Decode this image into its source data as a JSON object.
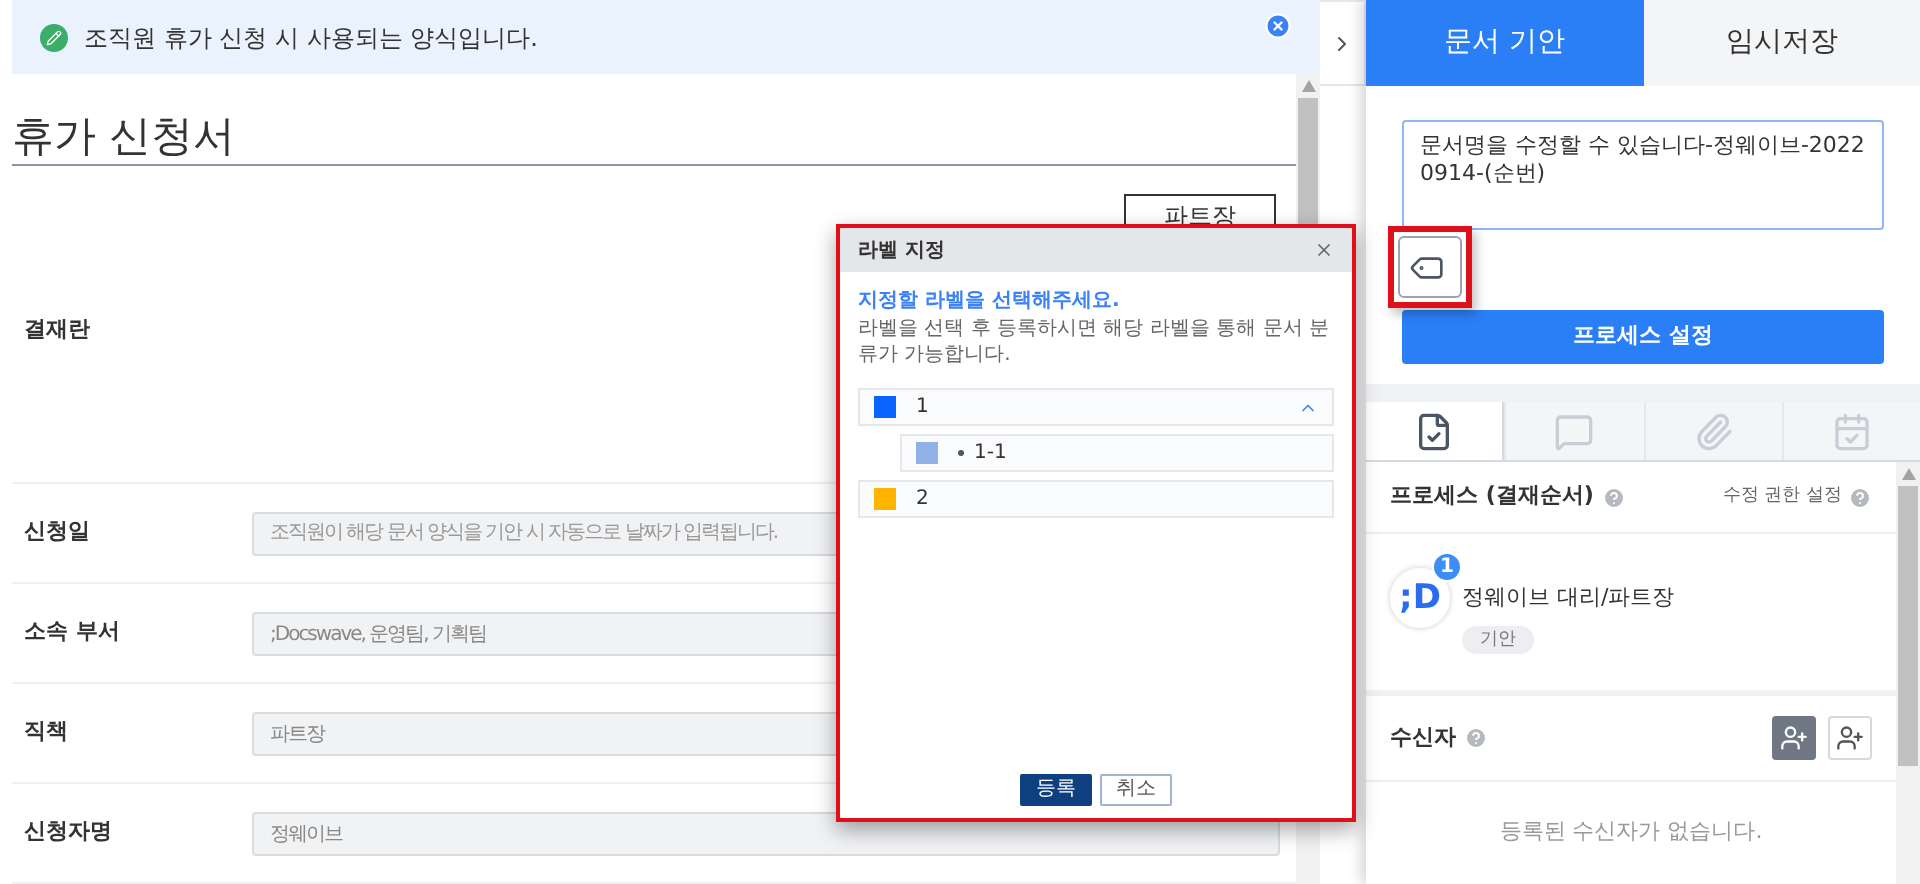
{
  "notice": {
    "text": "조직원 휴가 신청 시 사용되는 양식입니다."
  },
  "form": {
    "title": "휴가 신청서",
    "approval_label": "결재란",
    "approver_button": "파트장",
    "fields": [
      {
        "label": "신청일",
        "placeholder": "조직원이 해당 문서 양식을 기안 시 자동으로 날짜가 입력됩니다."
      },
      {
        "label": "소속 부서",
        "value": ";Docswave, 운영팀, 기획팀"
      },
      {
        "label": "직책",
        "value": "파트장"
      },
      {
        "label": "신청자명",
        "value": "정웨이브"
      }
    ]
  },
  "dialog": {
    "title": "라벨 지정",
    "prompt": "지정할 라벨을 선택해주세요.",
    "description": "라벨을 선택 후 등록하시면 해당 라벨을 통해 문서 분류가 가능합니다.",
    "labels": [
      {
        "name": "1",
        "color": "#0a64ff",
        "expanded": true,
        "children": [
          {
            "name": "1-1",
            "color": "#8fb1e8"
          }
        ]
      },
      {
        "name": "2",
        "color": "#ffb400"
      }
    ],
    "buttons": [
      {
        "label": "등록",
        "kind": "primary"
      },
      {
        "label": "취소",
        "kind": "secondary"
      }
    ]
  },
  "panel": {
    "tabs": [
      {
        "label": "문서 기안",
        "selected": true
      },
      {
        "label": "임시저장",
        "selected": false
      }
    ],
    "document_name": "문서명을 수정할 수 있습니다-정웨이브-20220914-(순번)",
    "process_button": "프로세스 설정",
    "icon_tabs": [
      {
        "kind": "document",
        "selected": true
      },
      {
        "kind": "comment",
        "selected": false
      },
      {
        "kind": "attachment",
        "selected": false
      },
      {
        "kind": "calendar",
        "selected": false
      }
    ],
    "process": {
      "heading": "프로세스 (결재순서)",
      "edit_permission": "수정 권한 설정",
      "approvers": [
        {
          "avatar_text": ";D",
          "badge": "1",
          "name": "정웨이브 대리/파트장",
          "role": "기안"
        }
      ]
    },
    "recipients": {
      "heading": "수신자",
      "empty_text": "등록된 수신자가 없습니다."
    }
  }
}
